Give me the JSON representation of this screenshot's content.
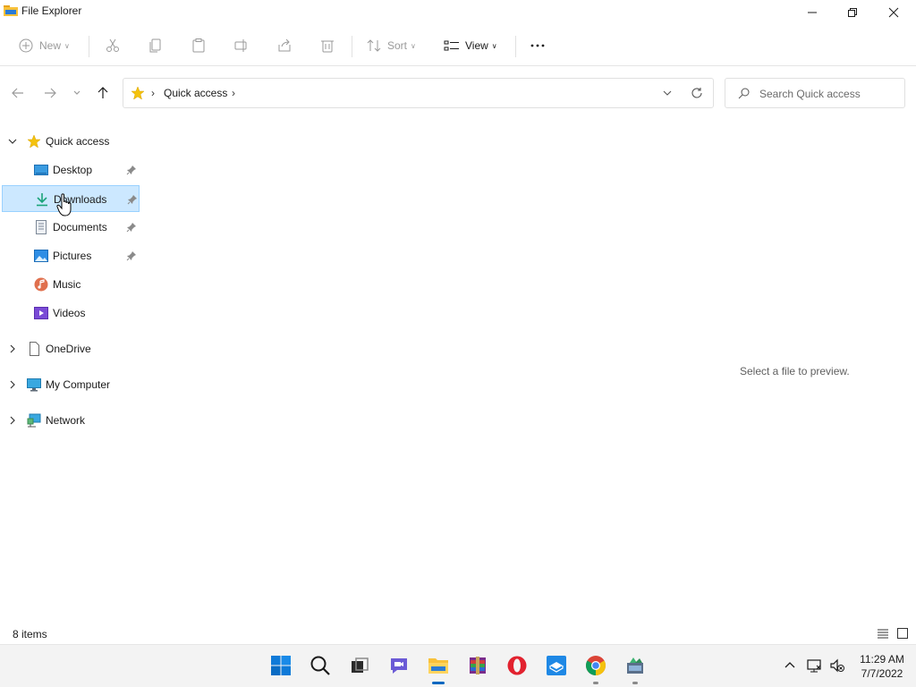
{
  "window": {
    "title": "File Explorer"
  },
  "toolbar": {
    "new_label": "New",
    "sort_label": "Sort",
    "view_label": "View"
  },
  "address": {
    "crumb": "Quick access",
    "sep": "›"
  },
  "search": {
    "placeholder": "Search Quick access"
  },
  "sidebar": {
    "quick_access": "Quick access",
    "items": [
      {
        "label": "Desktop",
        "icon": "desktop-icon",
        "pinned": true
      },
      {
        "label": "Downloads",
        "icon": "download-icon",
        "pinned": true,
        "selected": true
      },
      {
        "label": "Documents",
        "icon": "documents-icon",
        "pinned": true
      },
      {
        "label": "Pictures",
        "icon": "pictures-icon",
        "pinned": true
      },
      {
        "label": "Music",
        "icon": "music-icon",
        "pinned": false
      },
      {
        "label": "Videos",
        "icon": "videos-icon",
        "pinned": false
      }
    ],
    "onedrive": "OneDrive",
    "my_computer": "My Computer",
    "network": "Network"
  },
  "preview": {
    "text": "Select a file to preview."
  },
  "status": {
    "count": "8 items"
  },
  "taskbar": {
    "time": "11:29 AM",
    "date": "7/7/2022"
  },
  "colors": {
    "accent": "#0067c0",
    "selection_bg": "#cce8ff",
    "selection_border": "#99d1ff"
  }
}
